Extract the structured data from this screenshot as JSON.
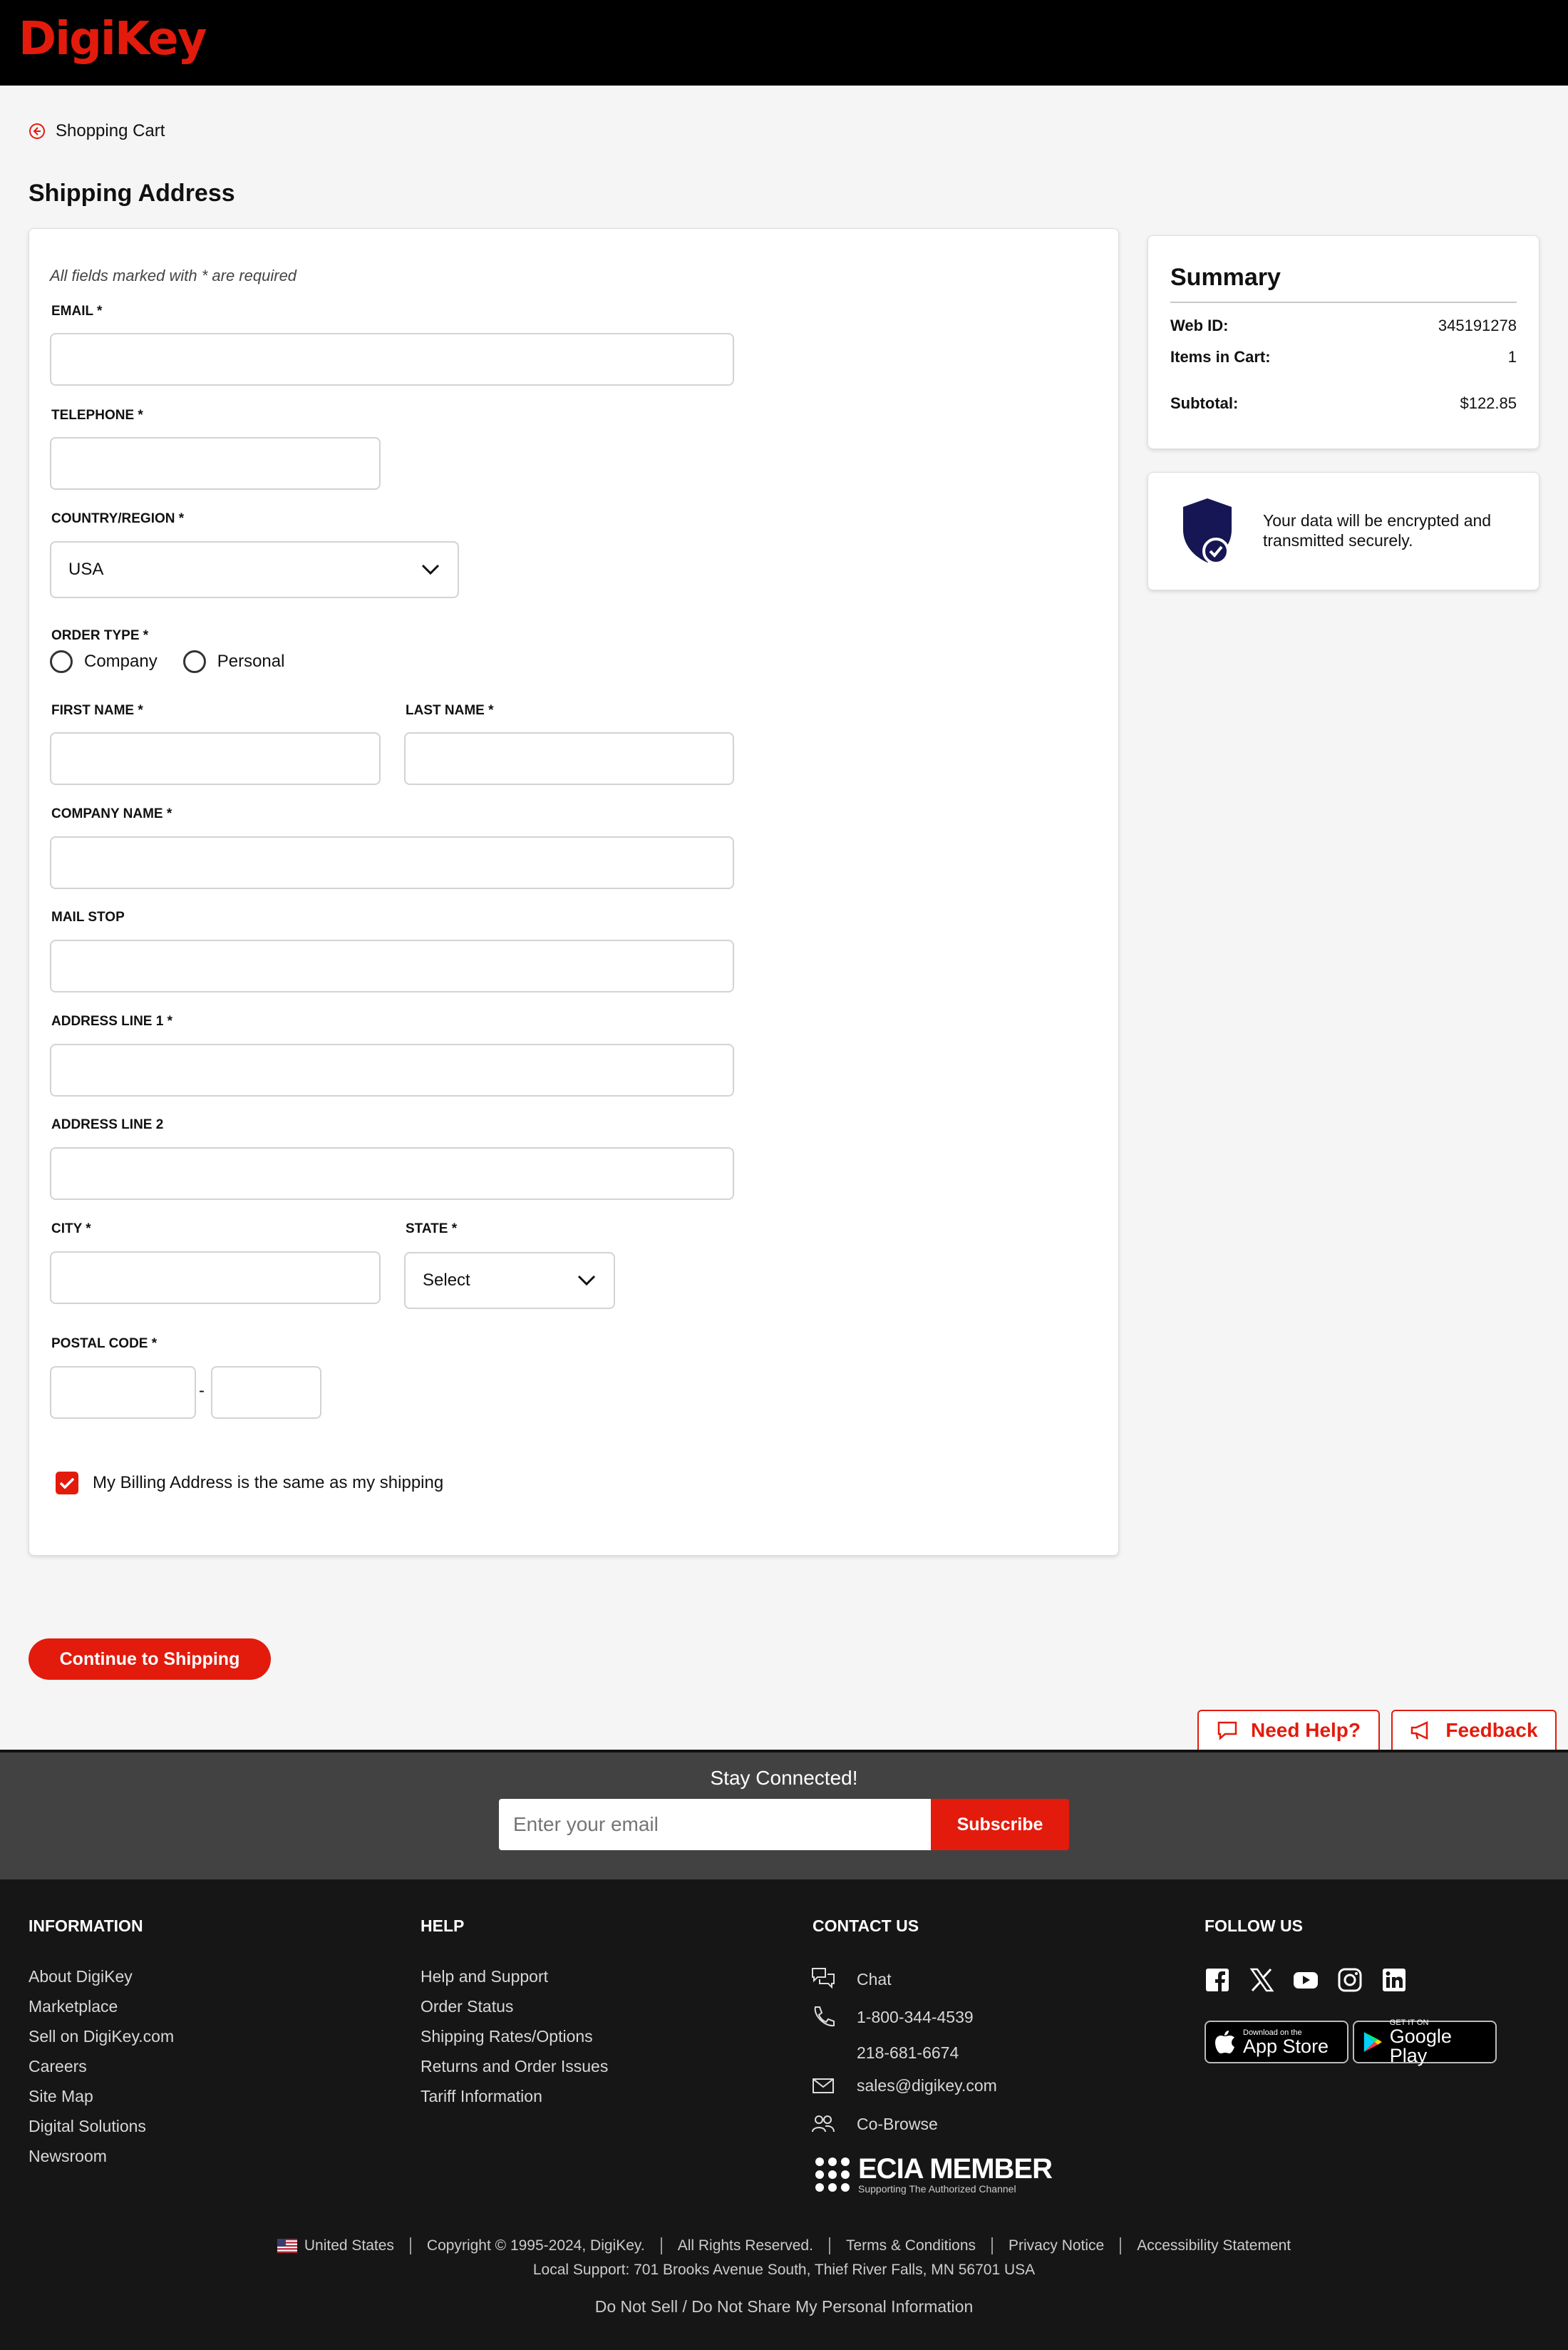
{
  "brand": {
    "logo_text": "DigiKey",
    "accent": "#e31b0c"
  },
  "nav": {
    "back_label": "Shopping Cart"
  },
  "page": {
    "title": "Shipping Address"
  },
  "form": {
    "required_note": "All fields marked with * are required",
    "email_label": "EMAIL *",
    "email_value": "",
    "telephone_label": "TELEPHONE *",
    "telephone_value": "",
    "country_label": "COUNTRY/REGION *",
    "country_value": "USA",
    "order_type_label": "ORDER TYPE *",
    "order_type_options": [
      "Company",
      "Personal"
    ],
    "first_name_label": "FIRST NAME *",
    "last_name_label": "LAST NAME *",
    "company_label": "COMPANY NAME *",
    "mail_stop_label": "MAIL STOP",
    "address1_label": "ADDRESS LINE 1 *",
    "address2_label": "ADDRESS LINE 2",
    "city_label": "CITY *",
    "state_label": "STATE *",
    "state_value": "Select",
    "postal_label": "POSTAL CODE *",
    "postal_dash": "-",
    "billing_same_label": "My Billing Address is the same as my shipping",
    "billing_same_checked": true
  },
  "actions": {
    "continue_label": "Continue to Shipping"
  },
  "summary": {
    "title": "Summary",
    "rows": [
      {
        "label": "Web ID:",
        "value": "345191278"
      },
      {
        "label": "Items in Cart:",
        "value": "1"
      },
      {
        "label": "Subtotal:",
        "value": "$122.85"
      }
    ]
  },
  "secure": {
    "text": "Your data will be encrypted and transmitted securely."
  },
  "tabs": {
    "need_help": "Need Help?",
    "feedback": "Feedback"
  },
  "newsletter": {
    "title": "Stay Connected!",
    "placeholder": "Enter your email",
    "subscribe": "Subscribe"
  },
  "footer": {
    "information": {
      "heading": "INFORMATION",
      "links": [
        "About DigiKey",
        "Marketplace",
        "Sell on DigiKey.com",
        "Careers",
        "Site Map",
        "Digital Solutions",
        "Newsroom"
      ]
    },
    "help": {
      "heading": "HELP",
      "links": [
        "Help and Support",
        "Order Status",
        "Shipping Rates/Options",
        "Returns and Order Issues",
        "Tariff Information"
      ]
    },
    "contact": {
      "heading": "CONTACT US",
      "chat": "Chat",
      "phone1": "1-800-344-4539",
      "phone2": "218-681-6674",
      "email": "sales@digikey.com",
      "cobrowse": "Co-Browse"
    },
    "follow": {
      "heading": "FOLLOW US",
      "socials": [
        "facebook-icon",
        "x-icon",
        "youtube-icon",
        "instagram-icon",
        "linkedin-icon"
      ]
    },
    "apps": {
      "appstore_small": "Download on the",
      "appstore_big": "App Store",
      "googleplay_small": "GET IT ON",
      "googleplay_big": "Google Play"
    },
    "ecia": {
      "big": "ECIA MEMBER",
      "small": "Supporting The Authorized Channel"
    },
    "legal": {
      "country": "United States",
      "copyright": "Copyright © 1995-2024, DigiKey.",
      "rights": "All Rights Reserved.",
      "terms": "Terms & Conditions",
      "privacy": "Privacy Notice",
      "accessibility": "Accessibility Statement",
      "local_support": "Local Support: 701 Brooks Avenue South, Thief River Falls, MN 56701 USA",
      "do_not_sell": "Do Not Sell / Do Not Share My Personal Information"
    }
  }
}
